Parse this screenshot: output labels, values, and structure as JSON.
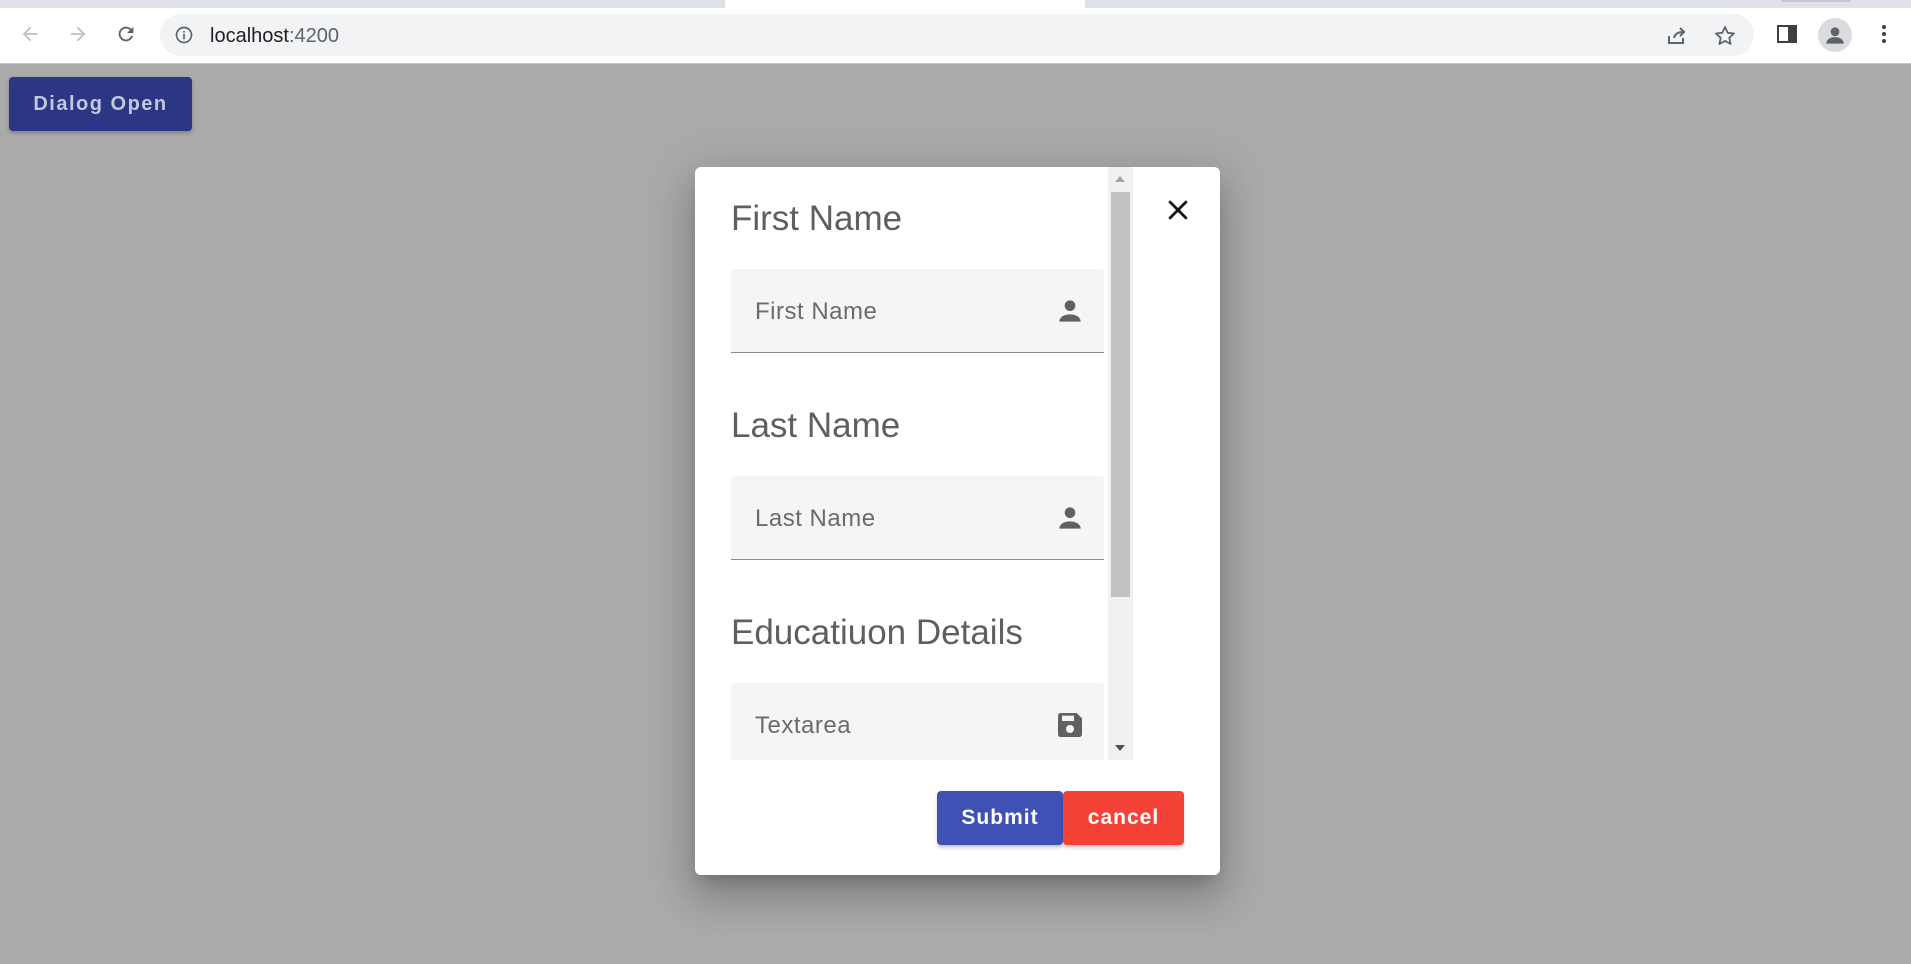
{
  "browser": {
    "url_host": "localhost",
    "url_port": ":4200"
  },
  "page": {
    "dialog_open_label": "Dialog Open"
  },
  "dialog": {
    "sections": [
      {
        "heading": "First Name",
        "placeholder": "First Name",
        "icon": "person-icon"
      },
      {
        "heading": "Last Name",
        "placeholder": "Last Name",
        "icon": "person-icon"
      },
      {
        "heading": "Educatiuon Details",
        "placeholder": "Textarea",
        "icon": "save-icon"
      }
    ],
    "submit_label": "Submit",
    "cancel_label": "cancel"
  },
  "colors": {
    "primary": "#3f51b5",
    "warn": "#f44336",
    "dialog_open_bg": "#2b3784",
    "backdrop": "#aaaaaa"
  }
}
